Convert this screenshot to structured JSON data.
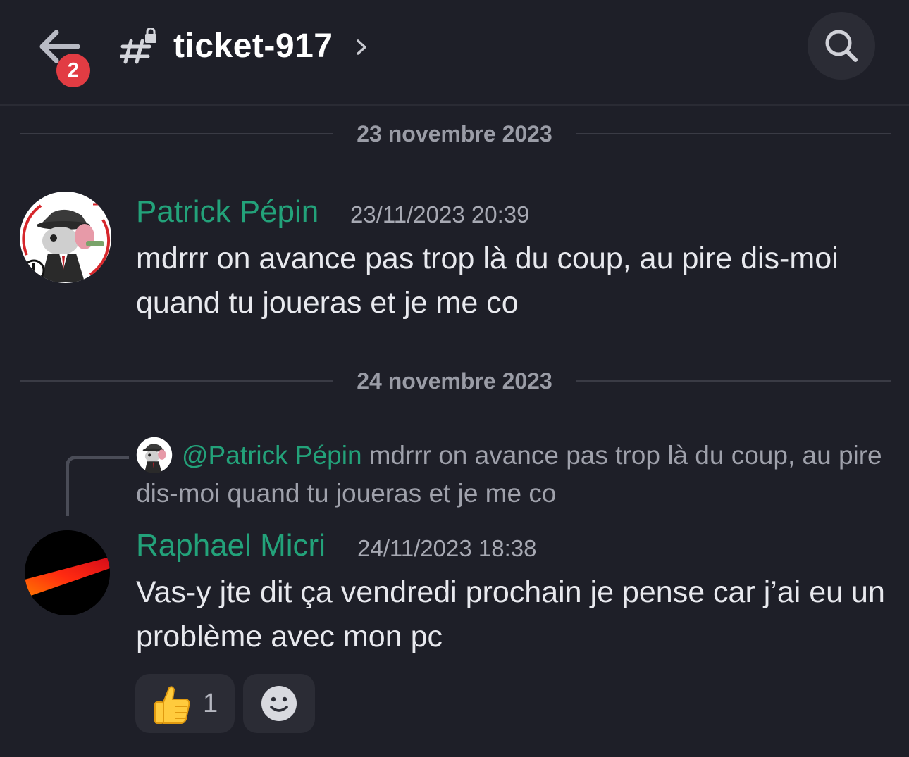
{
  "header": {
    "channel_name": "ticket-917",
    "unread_badge": "2"
  },
  "dividers": [
    {
      "date": "23 novembre 2023"
    },
    {
      "date": "24 novembre 2023"
    }
  ],
  "messages": [
    {
      "author": "Patrick Pépin",
      "timestamp": "23/11/2023 20:39",
      "text": "mdrrr on avance pas trop là du coup, au pire dis-moi quand tu joueras et je me co"
    },
    {
      "reply": {
        "mention": "@Patrick Pépin",
        "preview": "mdrrr on avance pas trop là du coup, au pire dis-moi quand tu joueras et je me co"
      },
      "author": "Raphael Micri",
      "timestamp": "24/11/2023 18:38",
      "text": "Vas-y jte dit ça vendredi prochain je pense car j’ai eu un problème avec mon pc",
      "reactions": [
        {
          "emoji": "thumbs-up",
          "count": "1"
        }
      ]
    }
  ],
  "colors": {
    "background": "#1e1f28",
    "author": "#23a27a",
    "badge": "#e23c43"
  }
}
